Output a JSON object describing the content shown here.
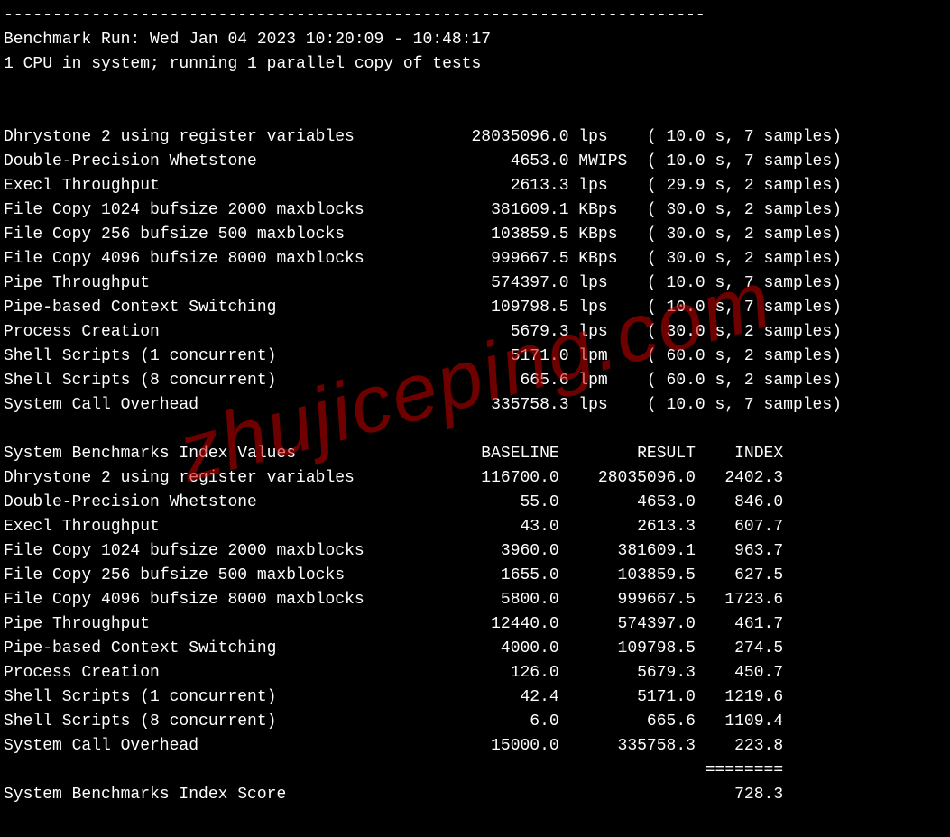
{
  "divider": "------------------------------------------------------------------------",
  "header": {
    "run_line": "Benchmark Run: Wed Jan 04 2023 10:20:09 - 10:48:17",
    "cpu_line": "1 CPU in system; running 1 parallel copy of tests"
  },
  "tests": [
    {
      "name": "Dhrystone 2 using register variables",
      "value": "28035096.0",
      "unit": "lps",
      "time": "10.0",
      "samples": "7"
    },
    {
      "name": "Double-Precision Whetstone",
      "value": "4653.0",
      "unit": "MWIPS",
      "time": "10.0",
      "samples": "7"
    },
    {
      "name": "Execl Throughput",
      "value": "2613.3",
      "unit": "lps",
      "time": "29.9",
      "samples": "2"
    },
    {
      "name": "File Copy 1024 bufsize 2000 maxblocks",
      "value": "381609.1",
      "unit": "KBps",
      "time": "30.0",
      "samples": "2"
    },
    {
      "name": "File Copy 256 bufsize 500 maxblocks",
      "value": "103859.5",
      "unit": "KBps",
      "time": "30.0",
      "samples": "2"
    },
    {
      "name": "File Copy 4096 bufsize 8000 maxblocks",
      "value": "999667.5",
      "unit": "KBps",
      "time": "30.0",
      "samples": "2"
    },
    {
      "name": "Pipe Throughput",
      "value": "574397.0",
      "unit": "lps",
      "time": "10.0",
      "samples": "7"
    },
    {
      "name": "Pipe-based Context Switching",
      "value": "109798.5",
      "unit": "lps",
      "time": "10.0",
      "samples": "7"
    },
    {
      "name": "Process Creation",
      "value": "5679.3",
      "unit": "lps",
      "time": "30.0",
      "samples": "2"
    },
    {
      "name": "Shell Scripts (1 concurrent)",
      "value": "5171.0",
      "unit": "lpm",
      "time": "60.0",
      "samples": "2"
    },
    {
      "name": "Shell Scripts (8 concurrent)",
      "value": "665.6",
      "unit": "lpm",
      "time": "60.0",
      "samples": "2"
    },
    {
      "name": "System Call Overhead",
      "value": "335758.3",
      "unit": "lps",
      "time": "10.0",
      "samples": "7"
    }
  ],
  "index_header": {
    "title": "System Benchmarks Index Values",
    "col_baseline": "BASELINE",
    "col_result": "RESULT",
    "col_index": "INDEX"
  },
  "index_rows": [
    {
      "name": "Dhrystone 2 using register variables",
      "baseline": "116700.0",
      "result": "28035096.0",
      "index": "2402.3"
    },
    {
      "name": "Double-Precision Whetstone",
      "baseline": "55.0",
      "result": "4653.0",
      "index": "846.0"
    },
    {
      "name": "Execl Throughput",
      "baseline": "43.0",
      "result": "2613.3",
      "index": "607.7"
    },
    {
      "name": "File Copy 1024 bufsize 2000 maxblocks",
      "baseline": "3960.0",
      "result": "381609.1",
      "index": "963.7"
    },
    {
      "name": "File Copy 256 bufsize 500 maxblocks",
      "baseline": "1655.0",
      "result": "103859.5",
      "index": "627.5"
    },
    {
      "name": "File Copy 4096 bufsize 8000 maxblocks",
      "baseline": "5800.0",
      "result": "999667.5",
      "index": "1723.6"
    },
    {
      "name": "Pipe Throughput",
      "baseline": "12440.0",
      "result": "574397.0",
      "index": "461.7"
    },
    {
      "name": "Pipe-based Context Switching",
      "baseline": "4000.0",
      "result": "109798.5",
      "index": "274.5"
    },
    {
      "name": "Process Creation",
      "baseline": "126.0",
      "result": "5679.3",
      "index": "450.7"
    },
    {
      "name": "Shell Scripts (1 concurrent)",
      "baseline": "42.4",
      "result": "5171.0",
      "index": "1219.6"
    },
    {
      "name": "Shell Scripts (8 concurrent)",
      "baseline": "6.0",
      "result": "665.6",
      "index": "1109.4"
    },
    {
      "name": "System Call Overhead",
      "baseline": "15000.0",
      "result": "335758.3",
      "index": "223.8"
    }
  ],
  "index_sep": "========",
  "final_score": {
    "label": "System Benchmarks Index Score",
    "value": "728.3"
  },
  "watermark": "zhujiceping.com"
}
